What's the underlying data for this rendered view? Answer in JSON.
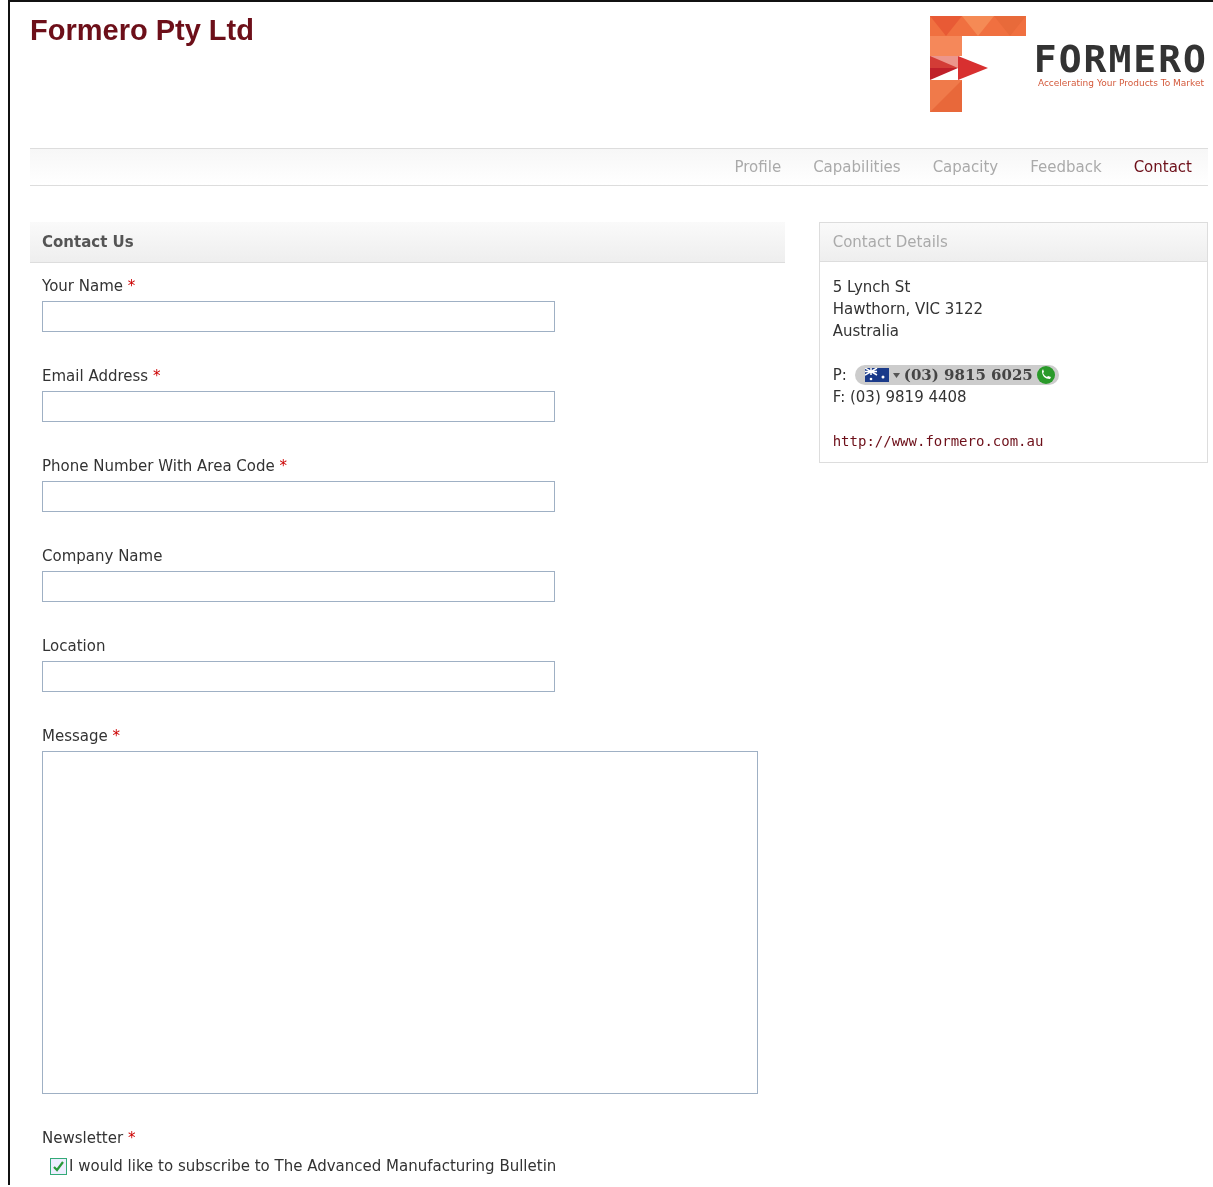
{
  "site_title": "Formero Pty Ltd",
  "logo": {
    "wordmark": "FORMERO",
    "tagline": "Accelerating Your Products To Market"
  },
  "nav": [
    {
      "label": "Profile",
      "selected": false
    },
    {
      "label": "Capabilities",
      "selected": false
    },
    {
      "label": "Capacity",
      "selected": false
    },
    {
      "label": "Feedback",
      "selected": false
    },
    {
      "label": "Contact",
      "selected": true
    }
  ],
  "form": {
    "title": "Contact Us",
    "fields": [
      {
        "label": "Your Name",
        "required": true,
        "kind": "text"
      },
      {
        "label": "Email Address",
        "required": true,
        "kind": "text"
      },
      {
        "label": "Phone Number With Area Code",
        "required": true,
        "kind": "text"
      },
      {
        "label": "Company Name",
        "required": false,
        "kind": "text"
      },
      {
        "label": "Location",
        "required": false,
        "kind": "text"
      },
      {
        "label": "Message",
        "required": true,
        "kind": "textarea"
      },
      {
        "label": "Newsletter",
        "required": true,
        "kind": "checkbox",
        "option": "I would like to subscribe to The Advanced Manufacturing Bulletin",
        "checked": true
      }
    ],
    "required_mark": "*"
  },
  "contact_details": {
    "title": "Contact Details",
    "address": [
      "5 Lynch St",
      "Hawthorn, VIC 3122",
      "Australia"
    ],
    "phone_prefix": "P:",
    "phone": "(03) 9815 6025",
    "fax": "F: (03) 9819 4408",
    "website": "http://www.formero.com.au"
  }
}
